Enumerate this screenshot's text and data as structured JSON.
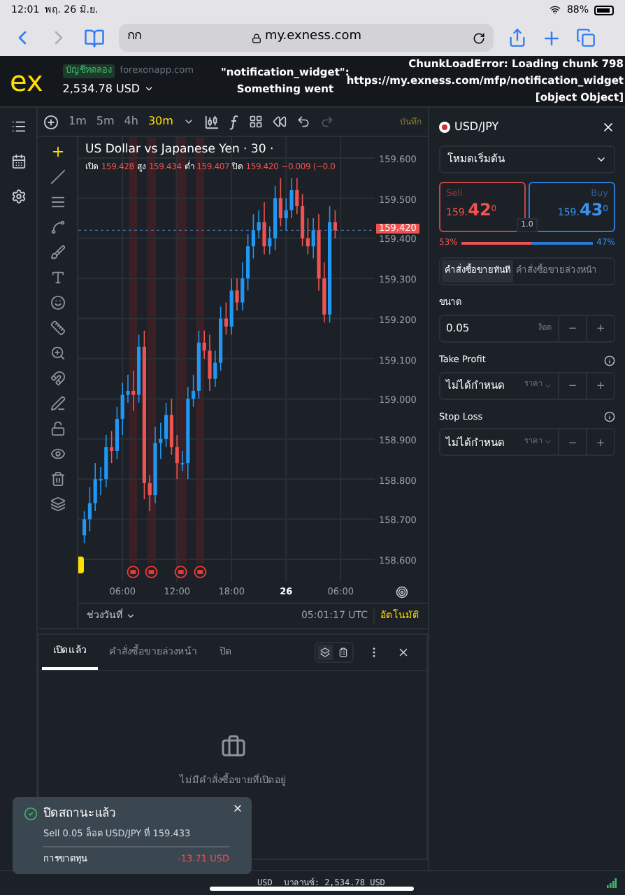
{
  "status_bar": {
    "time": "12:01",
    "date": "พฤ. 26 มิ.ย.",
    "battery": "88%"
  },
  "browser": {
    "text_button": "กก",
    "url": "my.exness.com"
  },
  "header": {
    "logo": "ex",
    "account_badge": "บัญชีทดลอง",
    "site": "forexonapp.com",
    "balance": "2,534.78 USD",
    "error_middle": [
      "\"notification_widget\":",
      "Something went"
    ],
    "error_right": [
      "ChunkLoadError: Loading chunk 798",
      "https://my.exness.com/mfp/notification_widget",
      "[object Object]"
    ]
  },
  "chart_toolbar": {
    "timeframes": [
      {
        "label": "1m",
        "selected": false
      },
      {
        "label": "5m",
        "selected": false
      },
      {
        "label": "4h",
        "selected": false
      },
      {
        "label": "30m",
        "selected": true
      }
    ],
    "save": "บันทึก"
  },
  "chart": {
    "title": "US Dollar vs Japanese Yen · 30 ·",
    "ohlc": [
      {
        "label": "เปิด",
        "value": "159.428"
      },
      {
        "label": "สูง",
        "value": "159.434"
      },
      {
        "label": "ต่ำ",
        "value": "159.407"
      },
      {
        "label": "ปิด",
        "value": "159.420"
      }
    ],
    "change": "−0.009 (−0.0",
    "current_price": "159.420",
    "chart_data": {
      "type": "candlestick",
      "ylim": [
        158.55,
        159.65
      ],
      "grid": true,
      "categories": [
        null,
        null,
        null,
        null,
        null,
        null,
        null,
        "06:00",
        null,
        null,
        null,
        null,
        null,
        null,
        null,
        null,
        null,
        "12:00",
        null,
        null,
        null,
        null,
        null,
        null,
        null,
        null,
        null,
        "18:00",
        null,
        null,
        null,
        null,
        null,
        null,
        null,
        null,
        null,
        "26",
        null,
        null,
        null,
        null,
        null,
        null,
        null,
        null,
        null,
        "06:00"
      ],
      "ref_lines": [
        {
          "axis": "y",
          "value": 159.42
        }
      ],
      "yticks": [
        {
          "value": 159.6,
          "label": "159.600"
        },
        {
          "value": 159.5,
          "label": "159.500"
        },
        {
          "value": 159.4,
          "label": "159.400"
        },
        {
          "value": 159.3,
          "label": "159.300"
        },
        {
          "value": 159.2,
          "label": "159.200"
        },
        {
          "value": 159.1,
          "label": "159.100"
        },
        {
          "value": 159.0,
          "label": "159.000"
        },
        {
          "value": 158.9,
          "label": "158.900"
        },
        {
          "value": 158.8,
          "label": "158.800"
        },
        {
          "value": 158.7,
          "label": "158.700"
        },
        {
          "value": 158.6,
          "label": "158.600"
        }
      ],
      "ohlc": [
        [
          158.66,
          158.72,
          158.64,
          158.7
        ],
        [
          158.7,
          158.78,
          158.67,
          158.74
        ],
        [
          158.74,
          158.84,
          158.72,
          158.8
        ],
        [
          158.8,
          158.83,
          158.76,
          158.8
        ],
        [
          158.8,
          158.91,
          158.78,
          158.88
        ],
        [
          158.88,
          158.92,
          158.84,
          158.87
        ],
        [
          158.87,
          158.98,
          158.85,
          158.95
        ],
        [
          158.95,
          159.04,
          158.91,
          159.01
        ],
        [
          159.01,
          159.06,
          158.99,
          159.02
        ],
        [
          159.02,
          159.07,
          158.97,
          159.01
        ],
        [
          159.01,
          159.16,
          158.99,
          159.13
        ],
        [
          159.13,
          159.17,
          158.75,
          158.79
        ],
        [
          158.79,
          158.81,
          158.72,
          158.76
        ],
        [
          158.76,
          158.93,
          158.74,
          158.89
        ],
        [
          158.89,
          158.94,
          158.85,
          158.9
        ],
        [
          158.9,
          158.99,
          158.88,
          158.96
        ],
        [
          158.96,
          159.0,
          158.86,
          158.88
        ],
        [
          158.88,
          158.91,
          158.8,
          158.84
        ],
        [
          158.84,
          158.87,
          158.82,
          158.84
        ],
        [
          158.84,
          159.03,
          158.8,
          159.0
        ],
        [
          159.0,
          159.06,
          158.98,
          159.02
        ],
        [
          159.02,
          159.17,
          159.0,
          159.14
        ],
        [
          159.14,
          159.17,
          159.1,
          159.12
        ],
        [
          159.12,
          159.16,
          159.02,
          159.05
        ],
        [
          159.05,
          159.12,
          159.03,
          159.09
        ],
        [
          159.09,
          159.23,
          159.07,
          159.2
        ],
        [
          159.2,
          159.24,
          159.16,
          159.18
        ],
        [
          159.18,
          159.3,
          159.16,
          159.27
        ],
        [
          159.27,
          159.3,
          159.22,
          159.24
        ],
        [
          159.24,
          159.34,
          159.22,
          159.3
        ],
        [
          159.3,
          159.41,
          159.27,
          159.38
        ],
        [
          159.38,
          159.46,
          159.35,
          159.42
        ],
        [
          159.42,
          159.47,
          159.4,
          159.44
        ],
        [
          159.44,
          159.49,
          159.36,
          159.38
        ],
        [
          159.38,
          159.43,
          159.36,
          159.4
        ],
        [
          159.4,
          159.53,
          159.37,
          159.5
        ],
        [
          159.5,
          159.55,
          159.43,
          159.45
        ],
        [
          159.45,
          159.5,
          159.42,
          159.47
        ],
        [
          159.47,
          159.55,
          159.45,
          159.52
        ],
        [
          159.52,
          159.55,
          159.46,
          159.48
        ],
        [
          159.48,
          159.51,
          159.38,
          159.4
        ],
        [
          159.4,
          159.45,
          159.36,
          159.38
        ],
        [
          159.38,
          159.45,
          159.35,
          159.42
        ],
        [
          159.42,
          159.46,
          159.27,
          159.3
        ],
        [
          159.3,
          159.34,
          159.19,
          159.21
        ],
        [
          159.21,
          159.48,
          159.19,
          159.44
        ],
        [
          159.44,
          159.47,
          159.4,
          159.42
        ],
        null
      ]
    },
    "time_labels_bold": [
      false,
      false,
      false,
      true,
      false
    ],
    "range": "ช่วงวันที่",
    "clock": "05:01:17 UTC",
    "auto": "อัตโนมัติ"
  },
  "order_panel": {
    "symbol": "USD/JPY",
    "mode": "โหมดเริ่มต้น",
    "sell": {
      "label": "Sell",
      "prefix": "159.",
      "big": "42",
      "sup": "0"
    },
    "buy": {
      "label": "Buy",
      "prefix": "159.",
      "big": "43",
      "sup": "0"
    },
    "spread": "1.0",
    "sentiment": {
      "sell_label": "53%",
      "buy_label": "47%",
      "level": 0.53
    },
    "order_tabs": [
      {
        "label": "คำสั่งซื้อขายทันที",
        "selected": true
      },
      {
        "label": "คำสั่งซื้อขายล่วงหน้า",
        "selected": false
      }
    ],
    "fields": [
      {
        "label": "ขนาด",
        "value": "0.05",
        "unit": "ล็อต",
        "dropdown": false,
        "info": false,
        "minus": "−",
        "plus": "+"
      },
      {
        "label": "Take Profit",
        "value": "ไม่ได้กำหนด",
        "unit": "ราคา",
        "dropdown": true,
        "info": true,
        "minus": "−",
        "plus": "+"
      },
      {
        "label": "Stop Loss",
        "value": "ไม่ได้กำหนด",
        "unit": "ราคา",
        "dropdown": true,
        "info": true,
        "minus": "−",
        "plus": "+"
      }
    ]
  },
  "positions_panel": {
    "tabs": [
      {
        "label": "เปิดแล้ว",
        "selected": true
      },
      {
        "label": "คำสั่งซื้อขายล่วงหน้า",
        "selected": false
      },
      {
        "label": "ปิด",
        "selected": false
      }
    ],
    "empty_message": "ไม่มีคำสั่งซื้อขายที่เปิดอยู่"
  },
  "toast": {
    "title": "ปิดสถานะแล้ว",
    "detail": "Sell 0.05 ล็อต USD/JPY ที่ 159.433",
    "loss_label": "การขาดทุน",
    "loss_value": "-13.71 USD"
  },
  "footer": {
    "hidden_tail": "USD",
    "balance": "บาลานซ์: 2,534.78 USD"
  }
}
